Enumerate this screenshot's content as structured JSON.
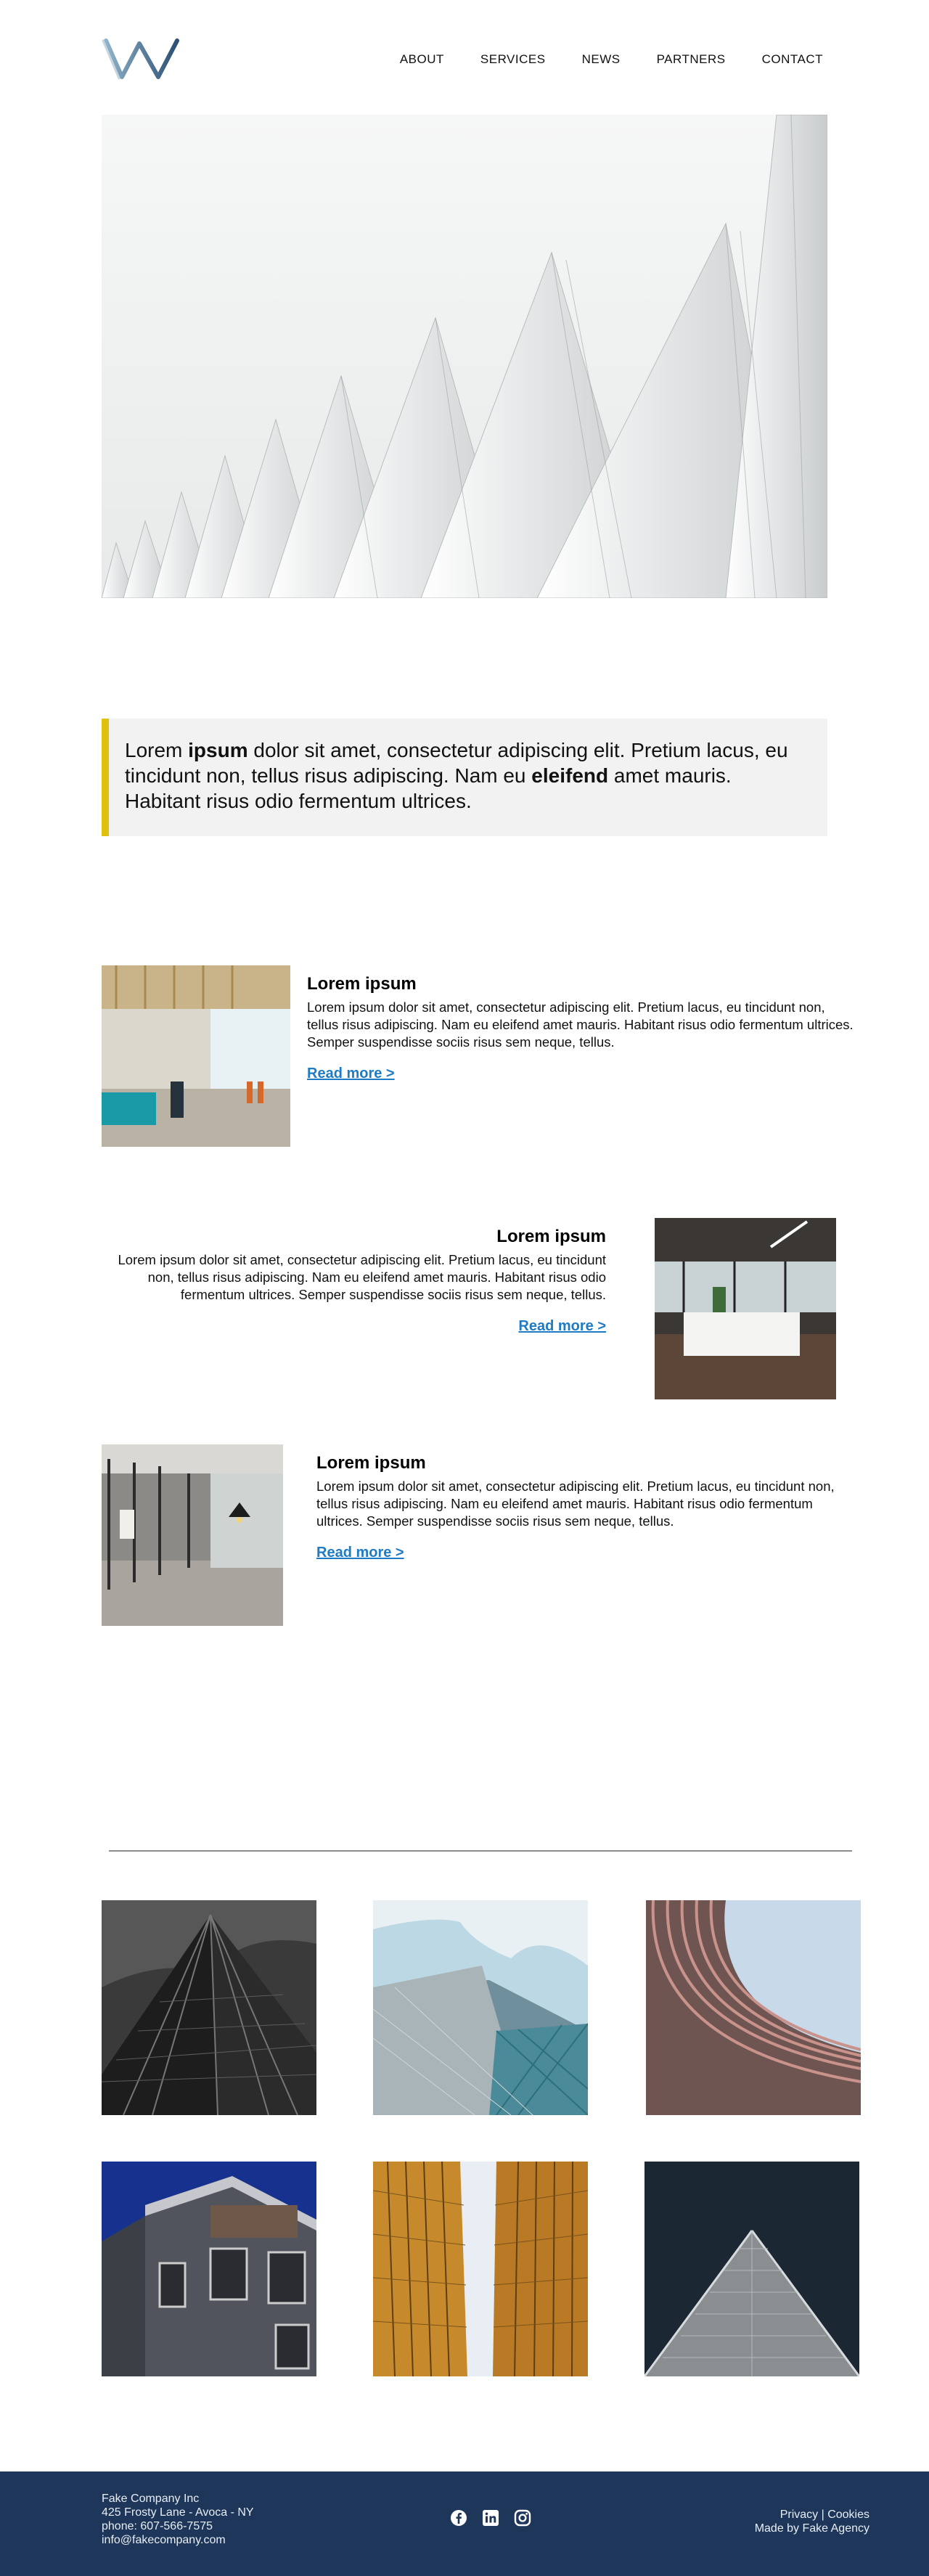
{
  "nav": {
    "items": [
      "ABOUT",
      "SERVICES",
      "NEWS",
      "PARTNERS",
      "CONTACT"
    ]
  },
  "quote": {
    "t1": "Lorem ",
    "b1": "ipsum",
    "t2": " dolor sit amet, consectetur adipiscing elit. Pretium lacus, eu tincidunt non, tellus risus adipiscing. Nam eu ",
    "b2": "eleifend",
    "t3": " amet mauris. Habitant risus odio fermentum ultrices."
  },
  "features": [
    {
      "title": "Lorem ipsum",
      "body": "Lorem ipsum dolor sit amet, consectetur adipiscing elit. Pretium lacus, eu tincidunt non, tellus risus adipiscing. Nam eu eleifend amet mauris. Habitant risus odio fermentum ultrices. Semper suspendisse sociis risus sem neque, tellus.",
      "link": "Read more >"
    },
    {
      "title": "Lorem ipsum",
      "body": "Lorem ipsum dolor sit amet, consectetur adipiscing elit. Pretium lacus, eu tincidunt non, tellus risus adipiscing. Nam eu eleifend amet mauris. Habitant risus odio fermentum ultrices. Semper suspendisse sociis risus sem neque, tellus.",
      "link": "Read more >"
    },
    {
      "title": "Lorem ipsum",
      "body": "Lorem ipsum dolor sit amet, consectetur adipiscing elit. Pretium lacus, eu tincidunt non, tellus risus adipiscing. Nam eu eleifend amet mauris. Habitant risus odio fermentum ultrices. Semper suspendisse sociis risus sem neque, tellus.",
      "link": "Read more >"
    }
  ],
  "footer": {
    "company": "Fake Company Inc",
    "address": "425 Frosty Lane - Avoca - NY",
    "phone": "phone: 607-566-7575",
    "email": "info@fakecompany.com",
    "social_icons": [
      "facebook-icon",
      "linkedin-icon",
      "instagram-icon"
    ],
    "legal": "Privacy | Cookies",
    "credit": "Made by Fake Agency"
  },
  "colors": {
    "accent_bar": "#dfc20f",
    "link": "#1f7bc4",
    "footer_bg": "#1e3659"
  }
}
